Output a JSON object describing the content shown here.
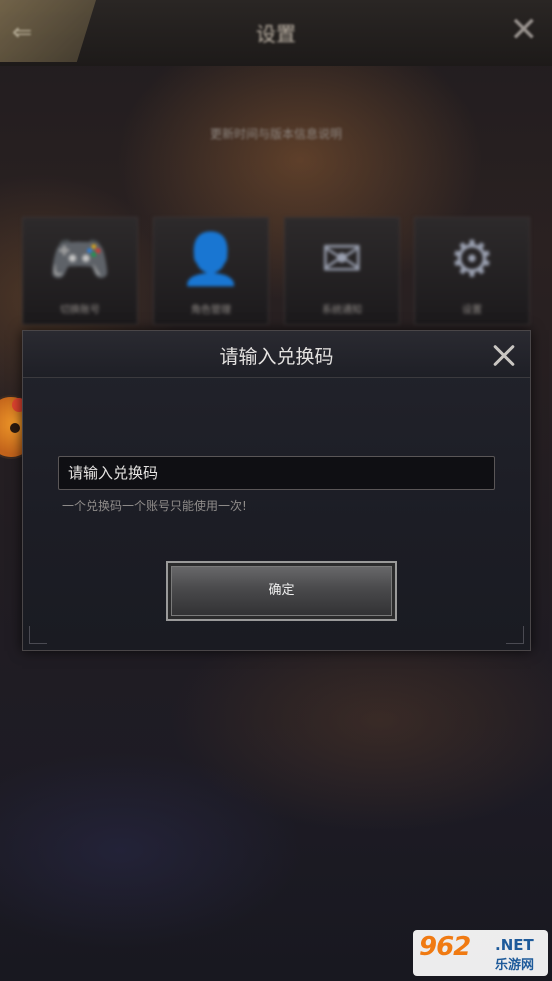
{
  "background": {
    "top_title": "设置",
    "subtitle": "更新时间与版本信息说明",
    "tiles": [
      {
        "icon": "gamepad-icon",
        "label": "切换账号"
      },
      {
        "icon": "avatar-icon",
        "label": "角色管理"
      },
      {
        "icon": "mail-icon",
        "label": "系统通知"
      },
      {
        "icon": "gear-icon",
        "label": "设置"
      }
    ]
  },
  "dialog": {
    "title": "请输入兑换码",
    "input_placeholder": "请输入兑换码",
    "hint": "一个兑换码一个账号只能使用一次!",
    "confirm_label": "确定"
  },
  "watermark": {
    "number": "962",
    "suffix": ".NET",
    "site_name": "乐游网"
  },
  "colors": {
    "dialog_bg": "#1c1d25",
    "accent_orange": "#f07a12",
    "badge_red": "#e0442f"
  }
}
